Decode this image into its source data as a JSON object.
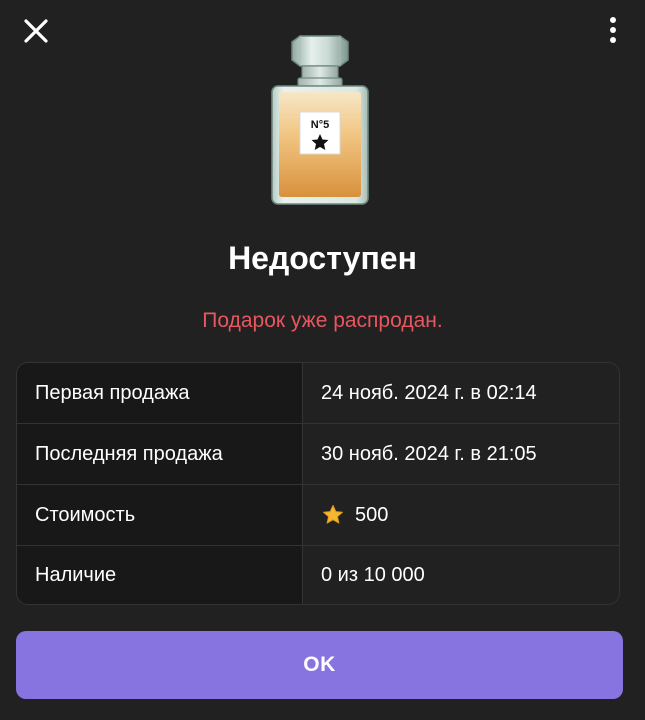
{
  "header": {
    "close_icon": "close-icon",
    "menu_icon": "more-vertical-icon"
  },
  "gift": {
    "image_icon": "perfume-bottle-icon",
    "label_text": "N°5",
    "status_title": "Недоступен",
    "status_message": "Подарок уже распродан.",
    "message_color": "#e8565f"
  },
  "info": {
    "rows": [
      {
        "label": "Первая продажа",
        "value": "24 нояб. 2024 г. в 02:14"
      },
      {
        "label": "Последняя продажа",
        "value": "30 нояб. 2024 г. в 21:05"
      },
      {
        "label": "Стоимость",
        "value": "500",
        "icon": "star-icon"
      },
      {
        "label": "Наличие",
        "value": "0 из 10 000"
      }
    ]
  },
  "actions": {
    "ok_label": "OK",
    "accent_color": "#8774e1"
  }
}
